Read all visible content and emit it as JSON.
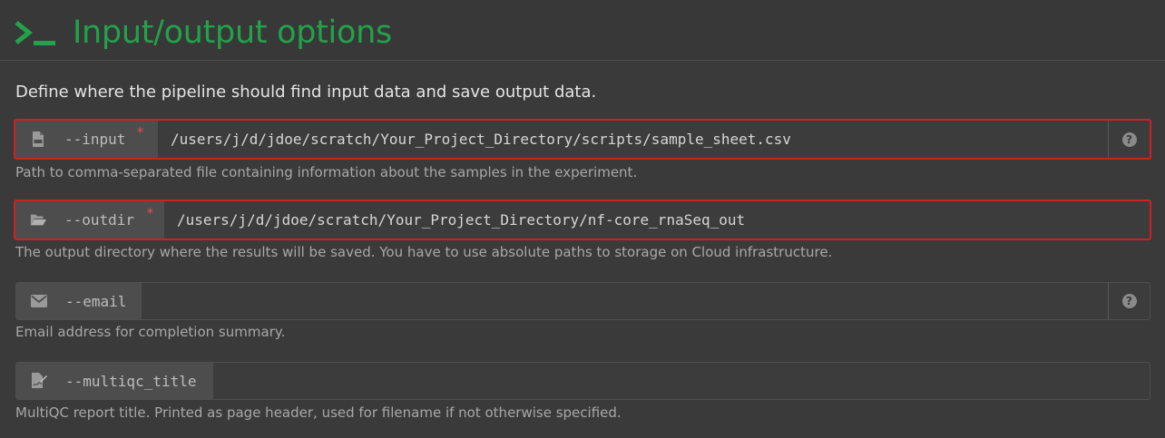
{
  "section": {
    "title": "Input/output options",
    "description": "Define where the pipeline should find input data and save output data."
  },
  "fields": [
    {
      "name": "--input",
      "required_mark": "*",
      "value": "/users/j/d/jdoe/scratch/Your_Project_Directory/scripts/sample_sheet.csv",
      "help": "Path to comma-separated file containing information about the samples in the experiment.",
      "icon": "file-csv-icon",
      "help_button": "?"
    },
    {
      "name": "--outdir",
      "required_mark": "*",
      "value": "/users/j/d/jdoe/scratch/Your_Project_Directory/nf-core_rnaSeq_out",
      "help": "The output directory where the results will be saved. You have to use absolute paths to storage on Cloud infrastructure.",
      "icon": "folder-open-icon"
    },
    {
      "name": "--email",
      "value": "",
      "help": "Email address for completion summary.",
      "icon": "envelope-icon",
      "help_button": "?"
    },
    {
      "name": "--multiqc_title",
      "value": "",
      "help": "MultiQC report title. Printed as page header, used for filename if not otherwise specified.",
      "icon": "file-signature-icon"
    }
  ],
  "colors": {
    "accent": "#22a24a",
    "highlight_border": "#cf2121",
    "background": "#3a3a3a"
  }
}
